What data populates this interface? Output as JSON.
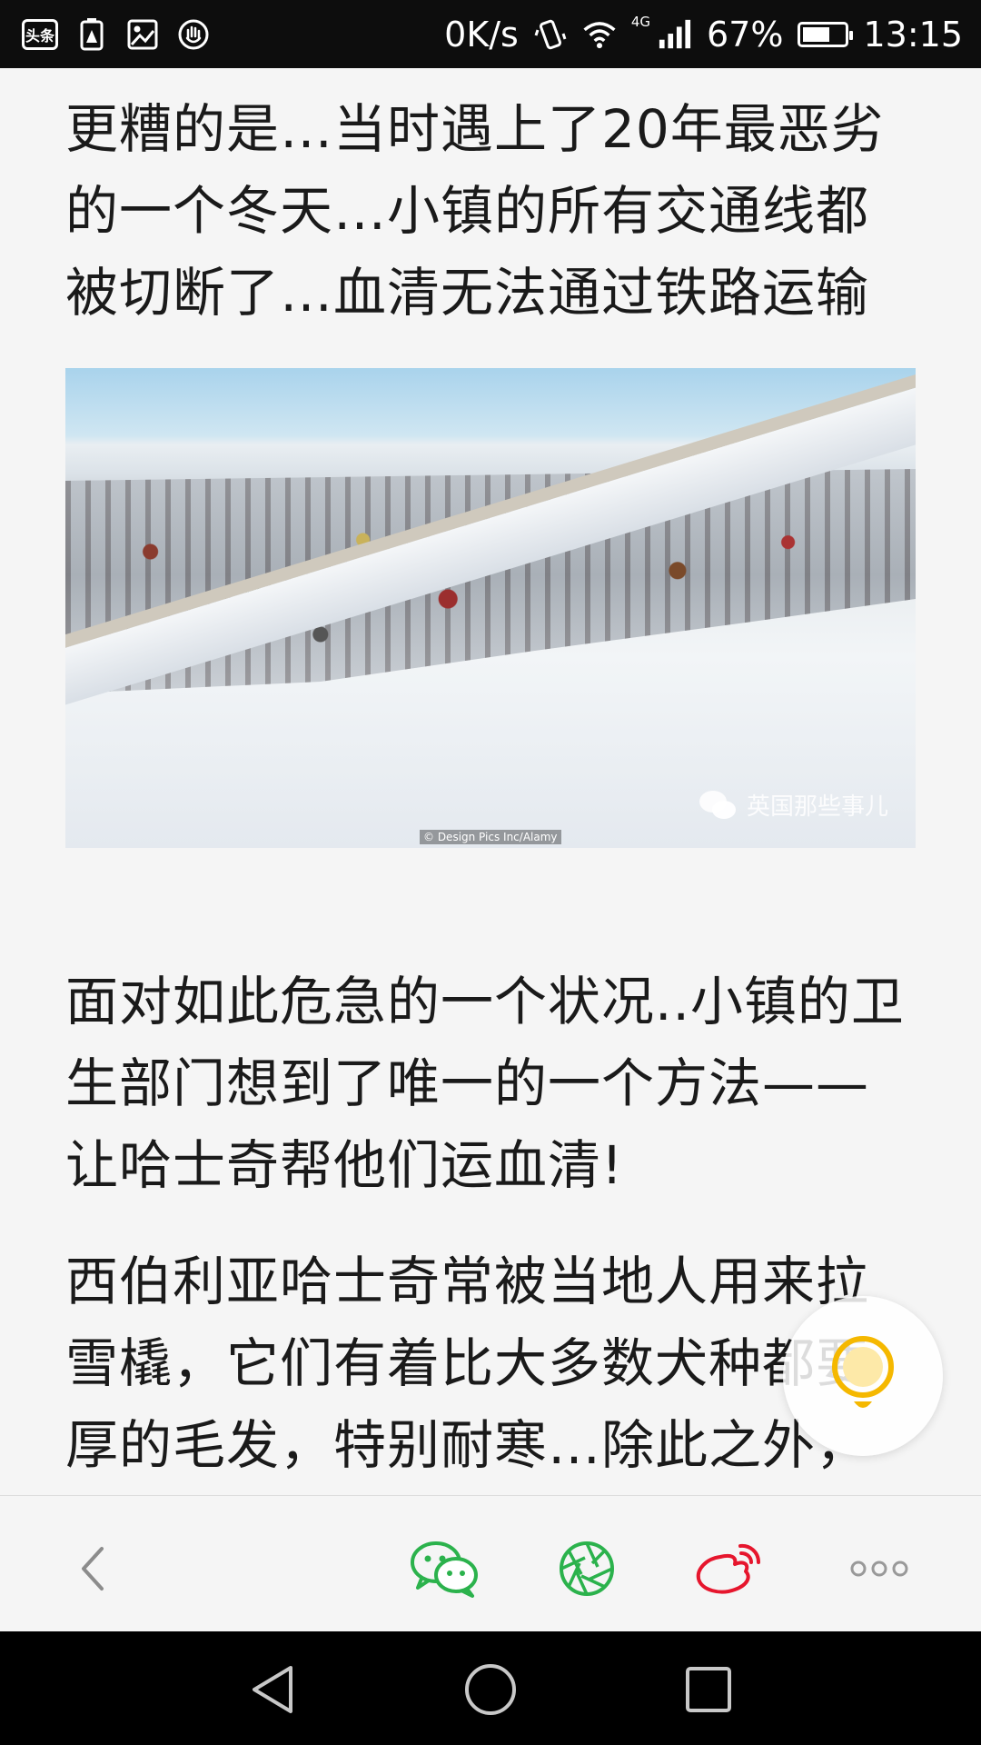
{
  "status_bar": {
    "app_badge": "头条",
    "net_speed": "0K/s",
    "network_type": "4G",
    "battery_percent": "67%",
    "battery_level": 0.67,
    "time": "13:15",
    "icons": [
      "toutiao-app-icon",
      "battery-warning-icon",
      "image-icon",
      "hand-icon",
      "vibrate-icon",
      "wifi-icon",
      "signal-icon",
      "battery-icon"
    ]
  },
  "article": {
    "paragraphs": [
      "更糟的是…当时遇上了20年最恶劣的一个冬天…小镇的所有交通线都被切断了…血清无法通过铁路运输",
      "面对如此危急的一个状况..小镇的卫生部门想到了唯一的一个方法——让哈士奇帮他们运血清!",
      "西伯利亚哈士奇常被当地人用来拉雪橇，它们有着比大多数犬种都要厚的毛发，特别耐寒…除此之外，它们体型小巧结实，胃口小，非常适应极地的气"
    ],
    "image": {
      "watermark": "英国那些事儿",
      "credit": "© Design Pics Inc/Alamy"
    }
  },
  "toolbar": {
    "items": [
      "back-icon",
      "wechat-share-icon",
      "moments-share-icon",
      "weibo-share-icon",
      "more-icon"
    ],
    "colors": {
      "wechat": "#2bb24c",
      "weibo": "#e6162d",
      "neutral": "#999999"
    }
  },
  "floating_button": {
    "icon": "lightbulb-icon",
    "color": "#f5b800"
  },
  "nav_bar": {
    "items": [
      "nav-back-icon",
      "nav-home-icon",
      "nav-recents-icon"
    ]
  }
}
